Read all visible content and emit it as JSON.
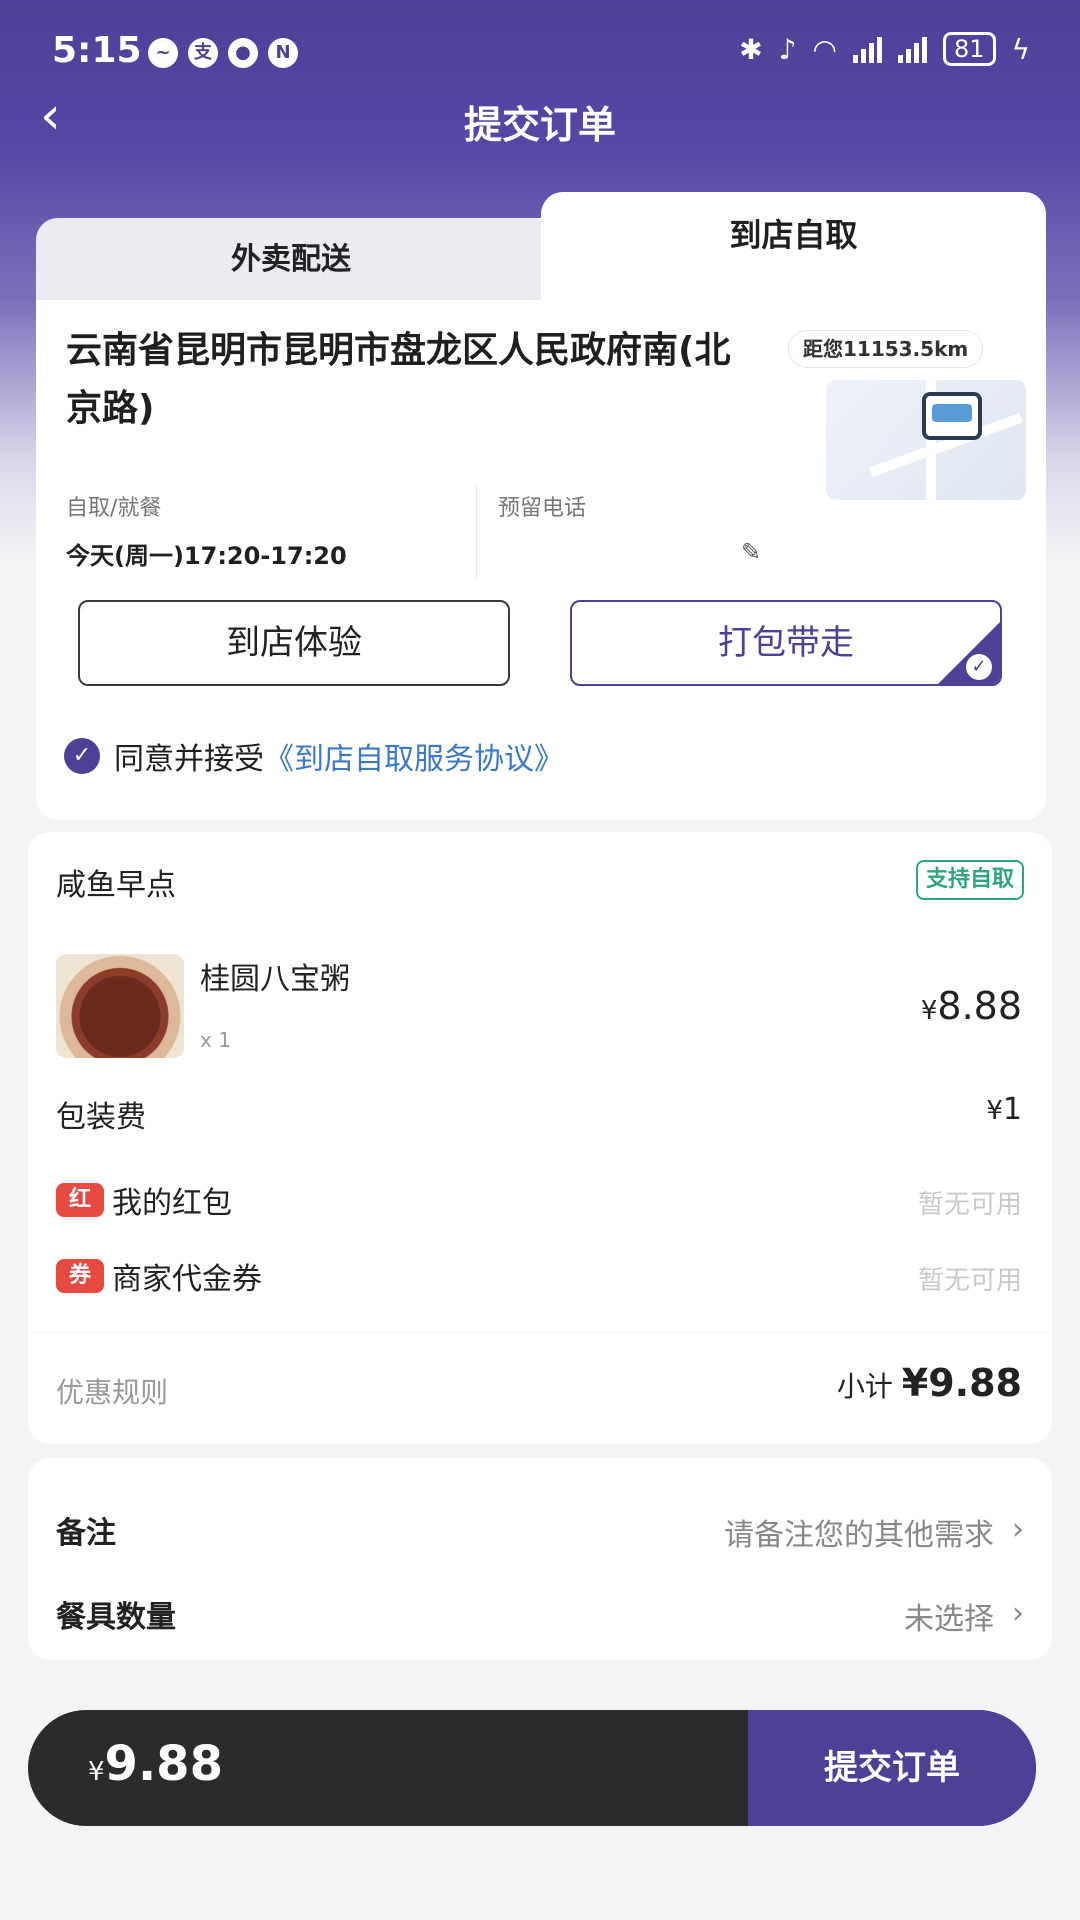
{
  "status_bar": {
    "time": "5:15",
    "battery": "81"
  },
  "nav": {
    "back_icon": "chevron-left-icon",
    "title": "提交订单"
  },
  "tabs": {
    "delivery": "外卖配送",
    "pickup": "到店自取",
    "active": "pickup"
  },
  "pickup": {
    "address": "云南省昆明市昆明市盘龙区人民政府南(北京路)",
    "distance": "距您11153.5km",
    "time_label": "自取/就餐",
    "time_value": "今天(周一)17:20-17:20",
    "phone_label": "预留电话",
    "phone_value": "",
    "mode_dine_in": "到店体验",
    "mode_takeaway": "打包带走",
    "selected_mode": "takeaway",
    "agree_text": "同意并接受",
    "agree_link": "《到店自取服务协议》",
    "agreed": true
  },
  "order": {
    "shop_name": "咸鱼早点",
    "pickup_badge": "支持自取",
    "items": [
      {
        "name": "桂圆八宝粥",
        "qty": "x 1",
        "currency": "¥",
        "price": "8.88"
      }
    ],
    "packaging_label": "包装费",
    "packaging_currency": "¥",
    "packaging_fee": "1",
    "red_packet_tag": "红",
    "red_packet_label": "我的红包",
    "red_packet_value": "暂无可用",
    "voucher_tag": "券",
    "voucher_label": "商家代金券",
    "voucher_value": "暂无可用",
    "promo_rules": "优惠规则",
    "subtotal_label": "小计",
    "subtotal_value": "¥9.88"
  },
  "notes": {
    "remark_label": "备注",
    "remark_placeholder": "请备注您的其他需求",
    "tableware_label": "餐具数量",
    "tableware_value": "未选择"
  },
  "footer": {
    "currency": "¥",
    "total": "9.88",
    "submit_label": "提交订单"
  },
  "colors": {
    "brand": "#4e3f97",
    "link": "#3c78c8",
    "badge_green": "#2ea57a",
    "tag_red": "#e64940",
    "footer_dark": "#2b2b2b"
  }
}
